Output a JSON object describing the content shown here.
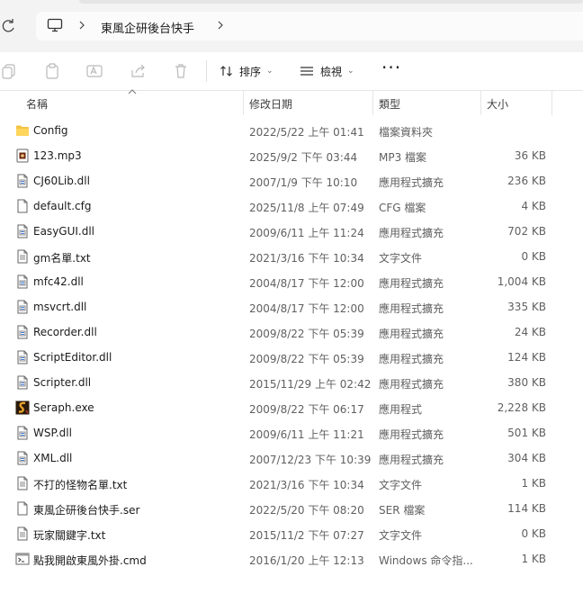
{
  "address": {
    "breadcrumb": "東風企研後台快手"
  },
  "toolbar": {
    "sort_label": "排序",
    "view_label": "檢視",
    "more_label": "···"
  },
  "columns": {
    "name": "名稱",
    "date": "修改日期",
    "type": "類型",
    "size": "大小"
  },
  "files": [
    {
      "name": "Config",
      "date": "2022/5/22 上午 01:41",
      "type": "檔案資料夾",
      "size": "",
      "icon": "folder"
    },
    {
      "name": "123.mp3",
      "date": "2025/9/2 下午 03:44",
      "type": "MP3 檔案",
      "size": "36 KB",
      "icon": "audio"
    },
    {
      "name": "CJ60Lib.dll",
      "date": "2007/1/9 下午 10:10",
      "type": "應用程式擴充",
      "size": "236 KB",
      "icon": "dll"
    },
    {
      "name": "default.cfg",
      "date": "2025/11/8 上午 07:49",
      "type": "CFG 檔案",
      "size": "4 KB",
      "icon": "file"
    },
    {
      "name": "EasyGUI.dll",
      "date": "2009/6/11 上午 11:24",
      "type": "應用程式擴充",
      "size": "702 KB",
      "icon": "dll"
    },
    {
      "name": "gm名單.txt",
      "date": "2021/3/16 下午 10:34",
      "type": "文字文件",
      "size": "0 KB",
      "icon": "text"
    },
    {
      "name": "mfc42.dll",
      "date": "2004/8/17 下午 12:00",
      "type": "應用程式擴充",
      "size": "1,004 KB",
      "icon": "dll"
    },
    {
      "name": "msvcrt.dll",
      "date": "2004/8/17 下午 12:00",
      "type": "應用程式擴充",
      "size": "335 KB",
      "icon": "dll"
    },
    {
      "name": "Recorder.dll",
      "date": "2009/8/22 下午 05:39",
      "type": "應用程式擴充",
      "size": "24 KB",
      "icon": "dll"
    },
    {
      "name": "ScriptEditor.dll",
      "date": "2009/8/22 下午 05:39",
      "type": "應用程式擴充",
      "size": "124 KB",
      "icon": "dll"
    },
    {
      "name": "Scripter.dll",
      "date": "2015/11/29 上午 02:42",
      "type": "應用程式擴充",
      "size": "380 KB",
      "icon": "dll"
    },
    {
      "name": "Seraph.exe",
      "date": "2009/8/22 下午 06:17",
      "type": "應用程式",
      "size": "2,228 KB",
      "icon": "exe"
    },
    {
      "name": "WSP.dll",
      "date": "2009/6/11 上午 11:21",
      "type": "應用程式擴充",
      "size": "501 KB",
      "icon": "dll"
    },
    {
      "name": "XML.dll",
      "date": "2007/12/23 下午 10:39",
      "type": "應用程式擴充",
      "size": "304 KB",
      "icon": "dll"
    },
    {
      "name": "不打的怪物名單.txt",
      "date": "2021/3/16 下午 10:34",
      "type": "文字文件",
      "size": "1 KB",
      "icon": "text"
    },
    {
      "name": "東風企研後台快手.ser",
      "date": "2022/5/20 下午 08:20",
      "type": "SER 檔案",
      "size": "114 KB",
      "icon": "file"
    },
    {
      "name": "玩家關鍵字.txt",
      "date": "2015/11/2 下午 07:27",
      "type": "文字文件",
      "size": "0 KB",
      "icon": "text"
    },
    {
      "name": "點我開啟東風外掛.cmd",
      "date": "2016/1/20 上午 12:13",
      "type": "Windows 命令指...",
      "size": "1 KB",
      "icon": "cmd"
    }
  ]
}
